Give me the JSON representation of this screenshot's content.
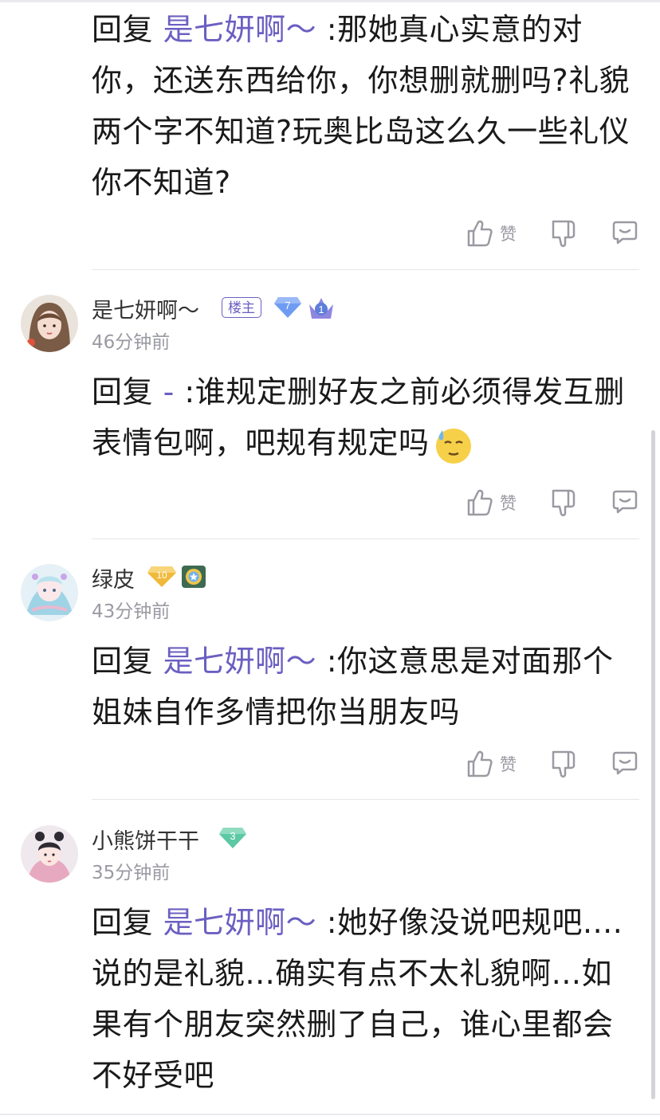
{
  "comments": [
    {
      "reply_prefix": "回复 ",
      "reply_to": "是七妍啊～",
      "reply_separator": " :",
      "text": "那她真心实意的对你，还送东西给你，你想删就删吗?礼貌两个字不知道?玩奥比岛这么久一些礼仪你不知道?",
      "like_label": "赞"
    },
    {
      "user": "是七妍啊～",
      "owner_tag": "楼主",
      "level": "7",
      "rank": "1",
      "time": "46分钟前",
      "reply_prefix": "回复 ",
      "reply_to": "-",
      "reply_separator": " :",
      "text": "谁规定删好友之前必须得发互删表情包啊，吧规有规定吗",
      "like_label": "赞"
    },
    {
      "user": "绿皮",
      "level": "10",
      "time": "43分钟前",
      "reply_prefix": "回复 ",
      "reply_to": "是七妍啊～",
      "reply_separator": " :",
      "text": "你这意思是对面那个姐妹自作多情把你当朋友吗",
      "like_label": "赞"
    },
    {
      "user": "小熊饼干干",
      "level": "3",
      "time": "35分钟前",
      "reply_prefix": "回复 ",
      "reply_to": "是七妍啊～",
      "reply_separator": " :",
      "text": "她好像没说吧规吧....说的是礼貌...确实有点不太礼貌啊...如果有个朋友突然删了自己，谁心里都会不好受吧"
    }
  ],
  "colors": {
    "reply_name": "#6b5fc2",
    "meta_gray": "#9a9aa3",
    "level_blue": "#6f9cf2",
    "level_gold": "#f1b93a",
    "level_green": "#5cc8a4"
  },
  "icons": {
    "like": "thumb-up-icon",
    "dislike": "thumb-down-icon",
    "reply": "comment-bubble-icon"
  }
}
